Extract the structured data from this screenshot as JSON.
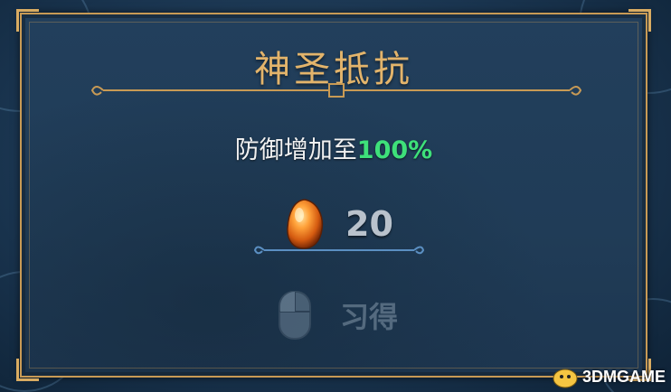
{
  "panel": {
    "title": "神圣抵抗",
    "description_prefix": "防御增加至",
    "description_value": "100%",
    "highlight_color": "#3ee07a",
    "title_color": "#e3b46b",
    "border_color": "#c89a55"
  },
  "cost": {
    "icon": "amber-gem-icon",
    "value": "20"
  },
  "action": {
    "icon": "mouse-icon",
    "label": "习得",
    "enabled": false
  },
  "watermark": {
    "text": "3DMGAME"
  }
}
